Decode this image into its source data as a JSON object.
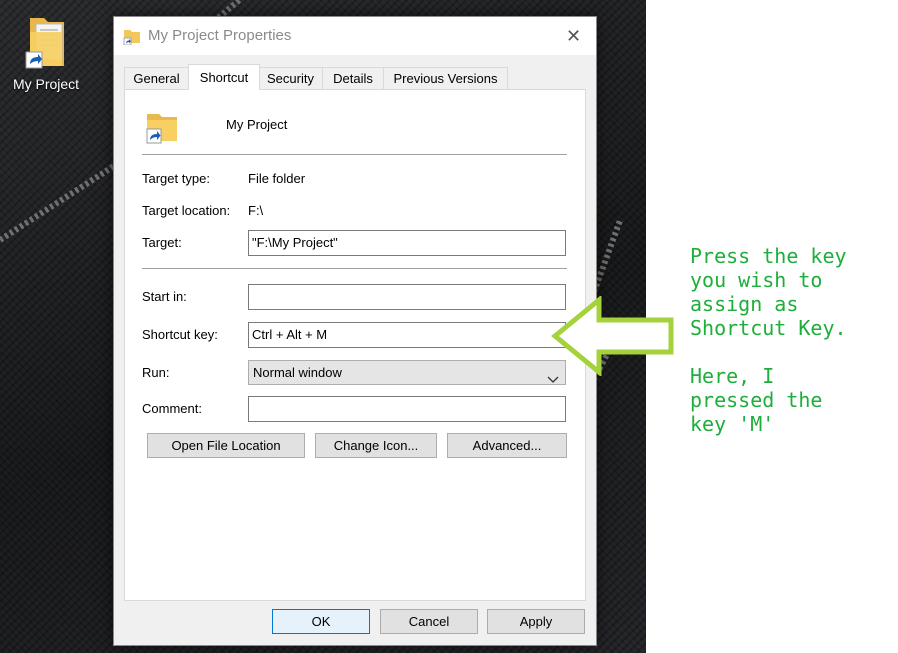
{
  "desktop": {
    "icon_label": "My Project"
  },
  "dialog": {
    "title": "My Project Properties",
    "tabs": [
      "General",
      "Shortcut",
      "Security",
      "Details",
      "Previous Versions"
    ],
    "active_tab": "Shortcut",
    "header_name": "My Project",
    "target_type_label": "Target type:",
    "target_type_value": "File folder",
    "target_location_label": "Target location:",
    "target_location_value": "F:\\",
    "target_label": "Target:",
    "target_value": "\"F:\\My Project\"",
    "start_in_label": "Start in:",
    "start_in_value": "",
    "shortcut_key_label": "Shortcut key:",
    "shortcut_key_value": "Ctrl + Alt + M",
    "run_label": "Run:",
    "run_value": "Normal window",
    "comment_label": "Comment:",
    "comment_value": "",
    "open_file_location_label": "Open File Location",
    "change_icon_label": "Change Icon...",
    "advanced_label": "Advanced...",
    "ok_label": "OK",
    "cancel_label": "Cancel",
    "apply_label": "Apply"
  },
  "annotation": {
    "text": "Press the key\nyou wish to\nassign as\nShortcut Key.\n\nHere, I\npressed the\nkey 'M'",
    "color": "#1eae3b",
    "arrow_color": "#a4d23a"
  },
  "colors": {
    "dialog_bg": "#f0f0f0",
    "default_button_border": "#0078d7"
  }
}
